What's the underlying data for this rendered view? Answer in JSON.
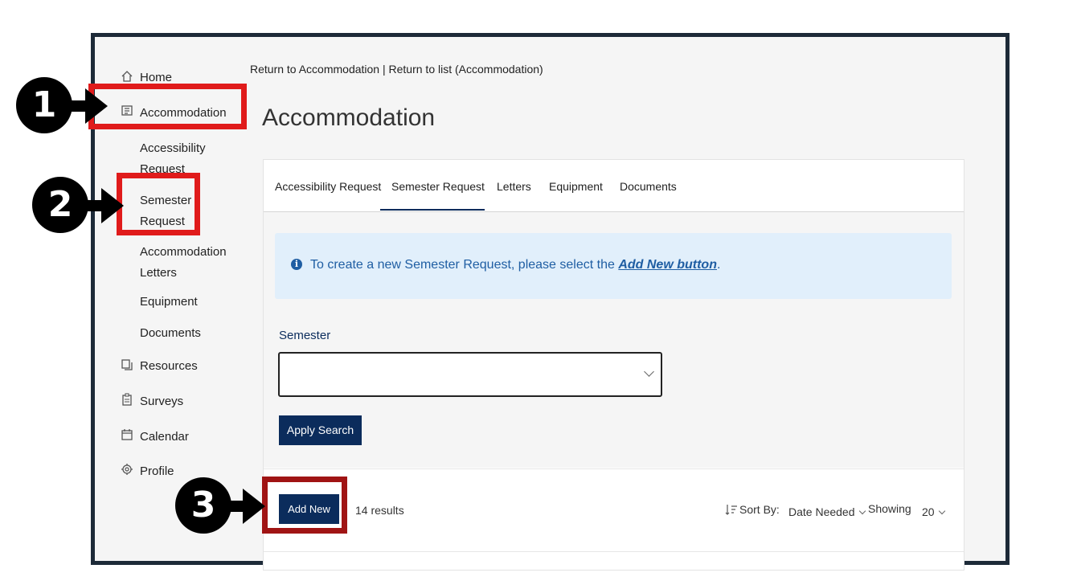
{
  "sidebar": {
    "items": [
      {
        "label": "Home",
        "icon": "home-icon"
      },
      {
        "label": "Accommodation",
        "icon": "list-icon"
      },
      {
        "label": "Accessibility Request"
      },
      {
        "label": "Semester Request"
      },
      {
        "label": "Accommodation Letters"
      },
      {
        "label": "Equipment"
      },
      {
        "label": "Documents"
      },
      {
        "label": "Resources",
        "icon": "copy-icon"
      },
      {
        "label": "Surveys",
        "icon": "clipboard-icon"
      },
      {
        "label": "Calendar",
        "icon": "calendar-icon"
      },
      {
        "label": "Profile",
        "icon": "gear-icon"
      }
    ]
  },
  "breadcrumb": {
    "link1": "Return to Accommodation",
    "sep": "|",
    "link2": "Return to list (Accommodation)"
  },
  "page": {
    "title": "Accommodation"
  },
  "tabs": [
    {
      "label": "Accessibility Request"
    },
    {
      "label": "Semester Request",
      "active": true
    },
    {
      "label": "Letters"
    },
    {
      "label": "Equipment"
    },
    {
      "label": "Documents"
    }
  ],
  "info": {
    "text": "To create a new Semester Request, please select the ",
    "link": "Add New button",
    "end": "."
  },
  "filter": {
    "semester_label": "Semester",
    "semester_value": "",
    "apply_label": "Apply Search"
  },
  "results": {
    "add_new_label": "Add New",
    "count_text": "14 results",
    "sort_label": "Sort By:",
    "sort_value": "Date Needed",
    "showing_label": "Showing",
    "showing_value": "20"
  },
  "callouts": [
    "1",
    "2",
    "3"
  ],
  "colors": {
    "primary": "#0b2c5c",
    "info_bg": "#e1effb",
    "info_text": "#1f5ea3",
    "highlight_red": "#e01b1b",
    "frame": "#1d2a38"
  }
}
